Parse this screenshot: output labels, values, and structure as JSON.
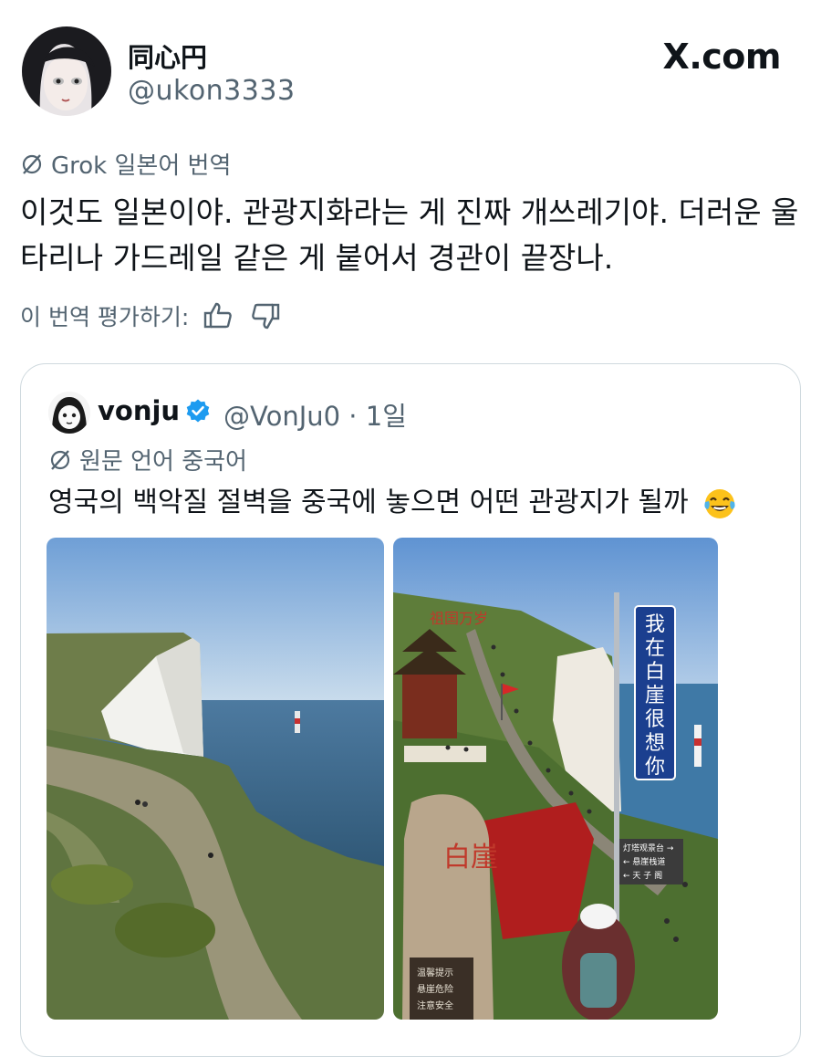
{
  "tweet": {
    "display_name": "同心円",
    "handle": "@ukon3333",
    "brand": "X.com",
    "translation_label": "Grok 일본어 번역",
    "translated_text": "이것도 일본이야. 관광지화라는 게 진짜 개쓰레기야. 더러운 울타리나 가드레일 같은 게 붙어서 경관이 끝장나.",
    "rate_label": "이 번역 평가하기:"
  },
  "quote": {
    "display_name": "vonju",
    "handle_time": "@VonJu0 · 1일",
    "original_language_label": "원문 언어 중국어",
    "text": "영국의 백악질 절벽을 중국에 놓으면 어떤 관광지가 될까",
    "emoji": "face-with-tears-of-joy"
  },
  "images": {
    "right_sign_vertical": "我在白崖很想你",
    "right_banner": "祖国万岁",
    "right_stone": "白崖",
    "right_signpost_lines": [
      "灯塔观景台 →",
      "← 悬崖栈道",
      "← 天 子 阁"
    ],
    "right_warning": [
      "温馨提示",
      "悬崖危险",
      "注意安全"
    ]
  },
  "colors": {
    "text_primary": "#0f1419",
    "text_secondary": "#536471",
    "border": "#cfd9de",
    "verified_blue": "#1d9bf0",
    "sign_blue": "#1b3f8f"
  }
}
